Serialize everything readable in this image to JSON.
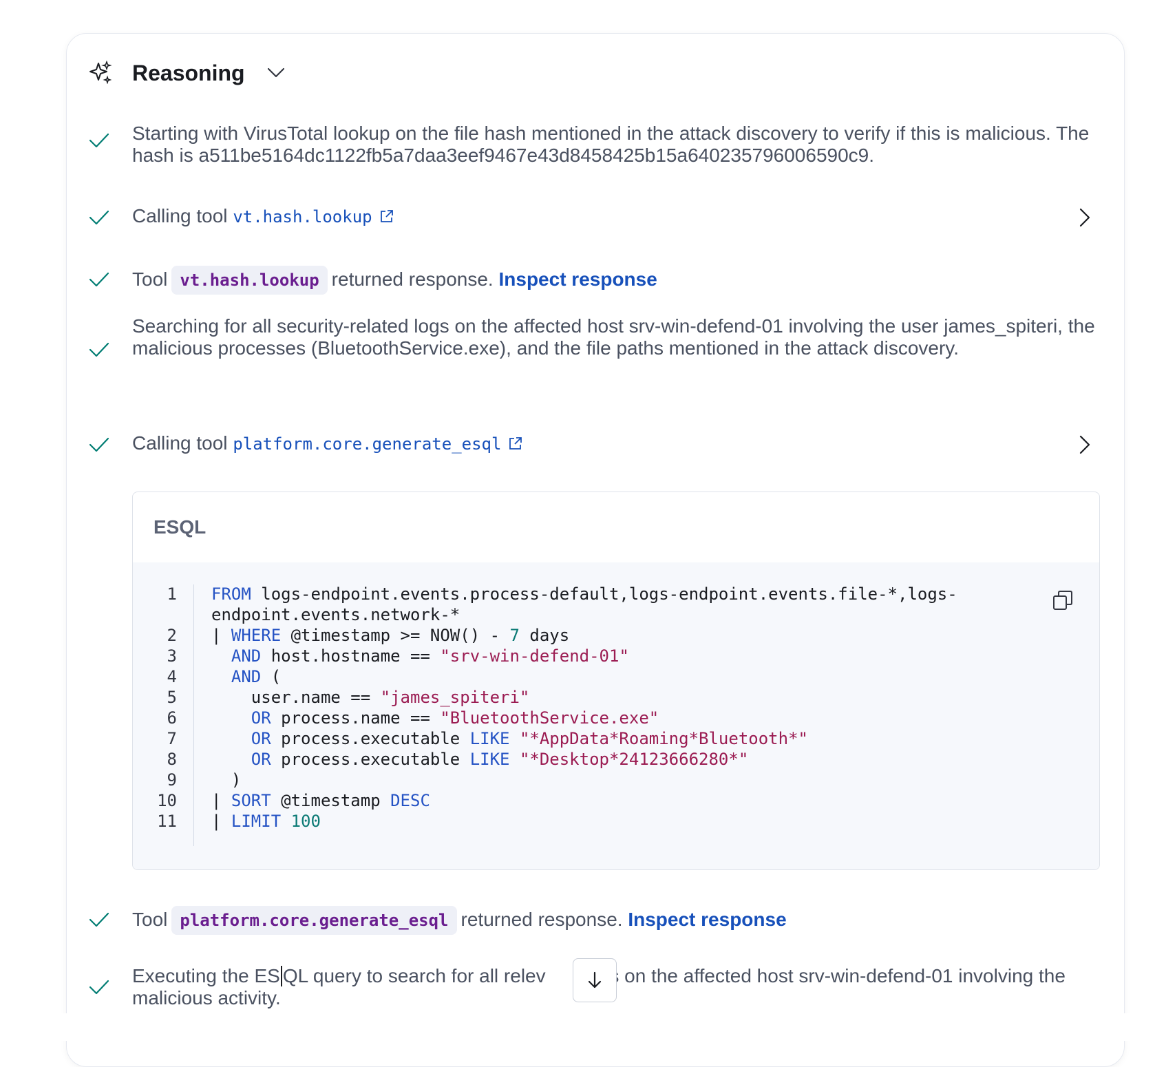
{
  "header": {
    "title": "Reasoning",
    "icon": "sparkle-icon",
    "toggle_icon": "chevron-down-icon"
  },
  "steps": [
    {
      "text": "Starting with VirusTotal lookup on the file hash mentioned in the attack discovery to verify if this is malicious. The hash is a511be5164dc1122fb5a7daa3eef9467e43d8458425b15a640235796006590c9."
    },
    {
      "prefix": "Calling tool ",
      "tool": "vt.hash.lookup"
    },
    {
      "prefix": "Tool",
      "tool": "vt.hash.lookup",
      "suffix": "returned response.",
      "link": "Inspect response"
    },
    {
      "text": "Searching for all security-related logs on the affected host srv-win-defend-01 involving the user james_spiteri, the malicious processes (BluetoothService.exe), and the file paths mentioned in the attack discovery."
    },
    {
      "prefix": "Calling tool ",
      "tool": "platform.core.generate_esql"
    },
    {
      "prefix": "Tool",
      "tool": "platform.core.generate_esql",
      "suffix": "returned response.",
      "link": "Inspect response"
    },
    {
      "text_before_cursor": "Executing the ES",
      "text_after_cursor": "QL query to search for all relev",
      "text_hidden_end": "ogs on the affected host srv-win-defend-01 involving the malicious activity."
    }
  ],
  "esql": {
    "title": "ESQL",
    "line_numbers": [
      "1",
      "2",
      "3",
      "4",
      "5",
      "6",
      "7",
      "8",
      "9",
      "10",
      "11"
    ],
    "lines": [
      "FROM logs-endpoint.events.process-default,logs-endpoint.events.file-*,logs-",
      "endpoint.events.network-*",
      "| WHERE @timestamp >= NOW() - 7 days",
      "  AND host.hostname == \"srv-win-defend-01\"",
      "  AND (",
      "    user.name == \"james_spiteri\"",
      "    OR process.name == \"BluetoothService.exe\"",
      "    OR process.executable LIKE \"*AppData*Roaming*Bluetooth*\"",
      "    OR process.executable LIKE \"*Desktop*24123666280*\"",
      "  )",
      "| SORT @timestamp DESC",
      "| LIMIT 100"
    ],
    "copy_icon": "copy-icon"
  },
  "scroll_button_icon": "arrow-down-icon",
  "colors": {
    "check": "#017d73",
    "link": "#1750ba",
    "pill_text": "#6a1e8f",
    "keyword": "#2553c4",
    "string": "#9b1c52",
    "number": "#0b7a75"
  }
}
